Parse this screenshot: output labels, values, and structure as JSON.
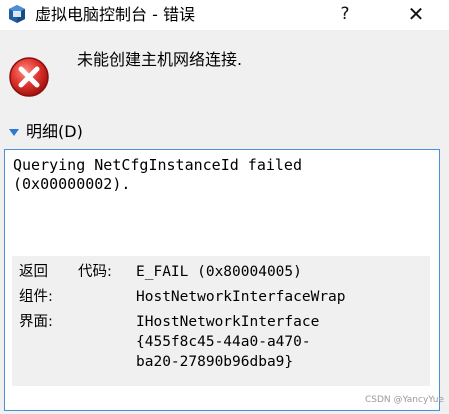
{
  "window": {
    "title": "虚拟电脑控制台 - 错误",
    "help_label": "?",
    "close_label": "✕"
  },
  "colors": {
    "error_red": "#d0312d",
    "accent": "#4a90d9"
  },
  "icons": {
    "app": "virtualbox-icon",
    "error": "error-icon",
    "toggle": "triangle-down-icon"
  },
  "message": "未能创建主机网络连接.",
  "details": {
    "label": "明细(D)",
    "text": "Querying NetCfgInstanceId failed\n(0x00000002).",
    "rows": [
      {
        "label": "返回",
        "caption": "代码:",
        "value": "E_FAIL (0x80004005)"
      },
      {
        "label": "组件:",
        "value": "HostNetworkInterfaceWrap"
      },
      {
        "label": "界面:",
        "value": "IHostNetworkInterface\n{455f8c45-44a0-a470-\nba20-27890b96dba9}"
      }
    ]
  },
  "watermark": "CSDN @YancyYue"
}
